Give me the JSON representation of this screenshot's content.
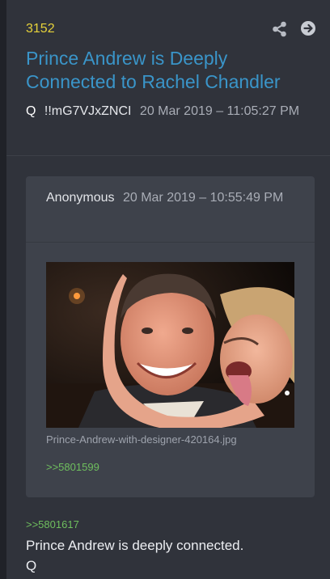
{
  "post": {
    "number": "3152",
    "title": "Prince Andrew is Deeply Connected to Rachel Chandler",
    "author": "Q",
    "tripcode": "!!mG7VJxZNCI",
    "date": "20 Mar 2019 – 11:05:27 PM",
    "icons": {
      "share": "share-icon",
      "next": "arrow-right-circle-icon"
    }
  },
  "quoted_post": {
    "author": "Anonymous",
    "date": "20 Mar 2019 – 10:55:49 PM",
    "image_alt": "Prince-Andrew-with-designer-420164.jpg",
    "filename": "Prince-Andrew-with-designer-420164.jpg",
    "reference": ">>5801599"
  },
  "reply": {
    "reference": ">>5801617",
    "lines": [
      "Prince Andrew is deeply connected.",
      "Q"
    ]
  },
  "colors": {
    "post_number": "#e6d23a",
    "title": "#3a95c9",
    "link_green": "#6fbf5e",
    "background": "#30333b",
    "card": "#3e424b"
  }
}
